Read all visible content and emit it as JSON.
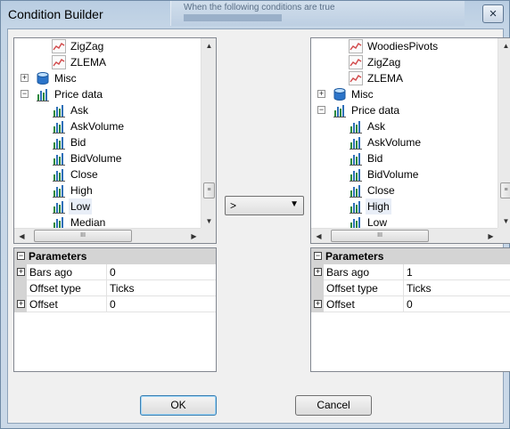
{
  "window": {
    "title": "Condition Builder",
    "background_hint": "When the following conditions are true"
  },
  "left_tree": {
    "items": [
      {
        "label": "ZigZag",
        "type": "indicator",
        "level": 2
      },
      {
        "label": "ZLEMA",
        "type": "indicator",
        "level": 2
      },
      {
        "label": "Misc",
        "type": "category-misc",
        "level": 1,
        "expander": "+"
      },
      {
        "label": "Price data",
        "type": "category-price",
        "level": 1,
        "expander": "−"
      },
      {
        "label": "Ask",
        "type": "price",
        "level": 2
      },
      {
        "label": "AskVolume",
        "type": "price",
        "level": 2
      },
      {
        "label": "Bid",
        "type": "price",
        "level": 2
      },
      {
        "label": "BidVolume",
        "type": "price",
        "level": 2
      },
      {
        "label": "Close",
        "type": "price",
        "level": 2
      },
      {
        "label": "High",
        "type": "price",
        "level": 2
      },
      {
        "label": "Low",
        "type": "price",
        "level": 2,
        "selected": true
      },
      {
        "label": "Median",
        "type": "price",
        "level": 2
      }
    ]
  },
  "right_tree": {
    "items": [
      {
        "label": "WoodiesPivots",
        "type": "indicator",
        "level": 2
      },
      {
        "label": "ZigZag",
        "type": "indicator",
        "level": 2
      },
      {
        "label": "ZLEMA",
        "type": "indicator",
        "level": 2
      },
      {
        "label": "Misc",
        "type": "category-misc",
        "level": 1,
        "expander": "+"
      },
      {
        "label": "Price data",
        "type": "category-price",
        "level": 1,
        "expander": "−"
      },
      {
        "label": "Ask",
        "type": "price",
        "level": 2
      },
      {
        "label": "AskVolume",
        "type": "price",
        "level": 2
      },
      {
        "label": "Bid",
        "type": "price",
        "level": 2
      },
      {
        "label": "BidVolume",
        "type": "price",
        "level": 2
      },
      {
        "label": "Close",
        "type": "price",
        "level": 2
      },
      {
        "label": "High",
        "type": "price",
        "level": 2,
        "selected": true
      },
      {
        "label": "Low",
        "type": "price",
        "level": 2
      }
    ]
  },
  "left_params": {
    "header": "Parameters",
    "rows": [
      {
        "name": "Bars ago",
        "value": "0",
        "expandable": true
      },
      {
        "name": "Offset type",
        "value": "Ticks",
        "expandable": false
      },
      {
        "name": "Offset",
        "value": "0",
        "expandable": true
      }
    ]
  },
  "right_params": {
    "header": "Parameters",
    "rows": [
      {
        "name": "Bars ago",
        "value": "1",
        "expandable": true
      },
      {
        "name": "Offset type",
        "value": "Ticks",
        "expandable": false
      },
      {
        "name": "Offset",
        "value": "0",
        "expandable": true
      }
    ]
  },
  "operator": {
    "value": ">"
  },
  "buttons": {
    "ok": "OK",
    "cancel": "Cancel"
  },
  "icons": {
    "close": "×",
    "scroll_up": "▲",
    "scroll_down": "▼",
    "scroll_left": "◀",
    "scroll_right": "▶",
    "dropdown": "▼",
    "grip_v": "≡",
    "grip_h": "III"
  },
  "colors": {
    "indicator_line": "#d2494a",
    "price_bar": "#2b8a3e",
    "misc_db": "#2b74c9",
    "selected_bg": "#e8eef7",
    "category_bg": "#d4d4d4"
  }
}
